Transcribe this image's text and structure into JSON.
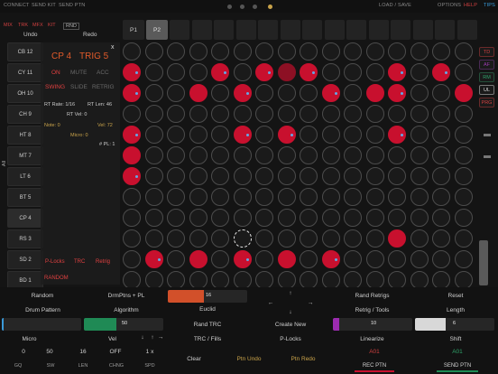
{
  "topbar": {
    "connect": "CONNECT",
    "send_kit": "SEND KIT",
    "send_ptn": "SEND PTN",
    "load_save": "LOAD / SAVE",
    "options": "OPTIONS",
    "help": "HELP",
    "tips": "TIPS"
  },
  "modes": {
    "mix": "MIX",
    "trk": "TRK",
    "mfx": "MFX",
    "kit": "KIT",
    "rnd": "RND"
  },
  "undo": "Undo",
  "redo": "Redo",
  "tracks": [
    "CB 12",
    "CY 11",
    "OH 10",
    "CH 9",
    "HT 8",
    "MT 7",
    "LT 6",
    "BT 5",
    "CP 4",
    "RS 3",
    "SD 2",
    "BD 1"
  ],
  "side_label": "All",
  "panel": {
    "close": "x",
    "title_track": "CP 4",
    "title_trig": "TRIG 5",
    "on": "ON",
    "mute": "MUTE",
    "acc": "ACC",
    "swing": "SWING",
    "slide": "SLIDE",
    "retrig": "RETRIG",
    "rt_rate": "RT Rate: 1/16",
    "rt_len": "RT Len: 46",
    "rt_vel": "RT Vel: 0",
    "note": "Note: 0",
    "vel": "Vel: 72",
    "micro": "Micro: 0",
    "fpl": "# PL: 1",
    "plocks": "P-Locks",
    "trc": "TRC",
    "retrig_btn": "Retrig",
    "random": "RANDOM"
  },
  "patterns": {
    "p1": "P1",
    "p2": "P2"
  },
  "right": {
    "td": "TD",
    "af": "AF",
    "rm": "RM",
    "ul": "UL",
    "prg": "PRG"
  },
  "bottom": {
    "random": "Random",
    "drumptns": "DrmPtns + PL",
    "drum_pattern": "Drum Pattern",
    "algorithm": "Algorithm",
    "slider_green_val": "50",
    "micro": "Micro",
    "vel": "Vel",
    "micro_val": "0",
    "v50": "50",
    "v16": "16",
    "off": "OFF",
    "onex": "1 x",
    "gq": "GQ",
    "sw": "SW",
    "len": "LEN",
    "chng": "CHNG",
    "spd": "SPD",
    "slider_orange_val": "16",
    "euclid": "Euclid",
    "rand_trc": "Rand TRC",
    "trc_fills": "TRC / Fills",
    "clear": "Clear",
    "ptn_undo": "Ptn Undo",
    "ptn_redo": "Ptn Redo",
    "create_new": "Create New",
    "plocks": "P-Locks",
    "rand_retrigs": "Rand Retrigs",
    "reset": "Reset",
    "retrig_tools": "Retrig / Tools",
    "length": "Length",
    "slider_purple_val": "10",
    "slider_white_val": "6",
    "linearize": "Linearize",
    "shift": "Shift",
    "a01_left": "A01",
    "a01_right": "A01",
    "rec_ptn": "REC PTN",
    "send_ptn": "SEND PTN"
  },
  "grid": {
    "rows": 12,
    "cols": 16,
    "on": [
      [
        1,
        0
      ],
      [
        1,
        4
      ],
      [
        1,
        6
      ],
      [
        1,
        8
      ],
      [
        1,
        12
      ],
      [
        1,
        14
      ],
      [
        2,
        0
      ],
      [
        2,
        3
      ],
      [
        2,
        5
      ],
      [
        2,
        9
      ],
      [
        2,
        11
      ],
      [
        2,
        12
      ],
      [
        2,
        15
      ],
      [
        4,
        0
      ],
      [
        4,
        5
      ],
      [
        4,
        7
      ],
      [
        4,
        12
      ],
      [
        5,
        0
      ],
      [
        6,
        0
      ],
      [
        9,
        12
      ],
      [
        10,
        1
      ],
      [
        10,
        3
      ],
      [
        10,
        5
      ],
      [
        10,
        7
      ],
      [
        10,
        9
      ]
    ],
    "dim": [
      [
        1,
        7
      ]
    ],
    "locks": [
      [
        1,
        0
      ],
      [
        1,
        4
      ],
      [
        1,
        6
      ],
      [
        1,
        8
      ],
      [
        1,
        12
      ],
      [
        1,
        14
      ],
      [
        2,
        0
      ],
      [
        2,
        5
      ],
      [
        2,
        9
      ],
      [
        2,
        12
      ],
      [
        4,
        0
      ],
      [
        4,
        5
      ],
      [
        4,
        7
      ],
      [
        4,
        12
      ],
      [
        6,
        0
      ],
      [
        10,
        1
      ],
      [
        10,
        5
      ],
      [
        10,
        9
      ]
    ],
    "cursor": [
      9,
      5
    ]
  },
  "colors": {
    "accent": "#c8102e",
    "lock": "#64a8e6",
    "green": "#1f8a55",
    "orange": "#d2502a",
    "purple": "#9c2bb0"
  }
}
